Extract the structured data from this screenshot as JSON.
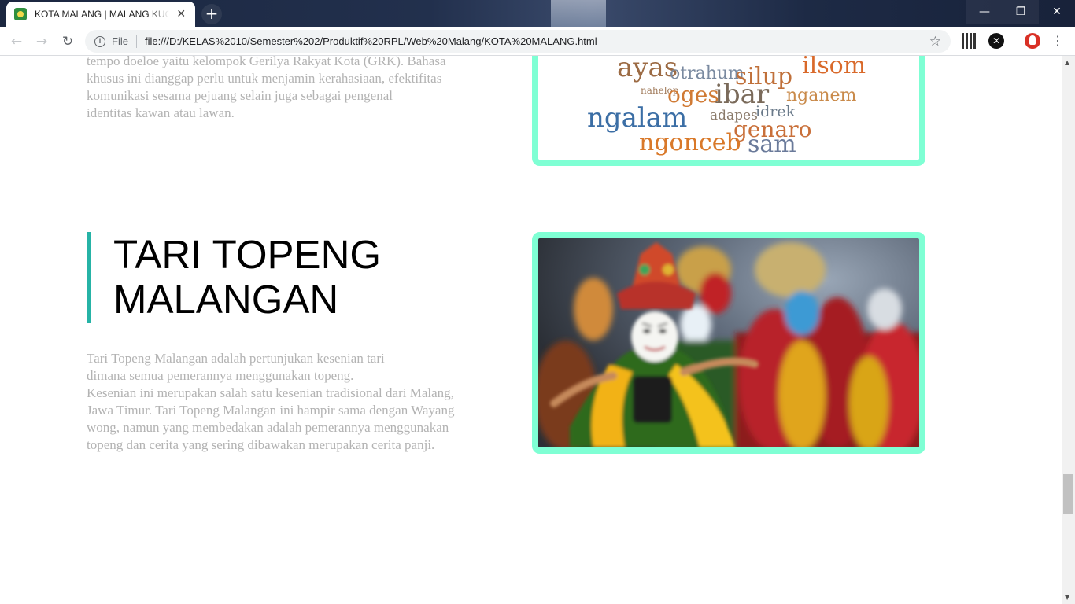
{
  "browser": {
    "tab_title": "KOTA MALANG | MALANG KUCECWARA",
    "tab_close": "✕",
    "new_tab": "+",
    "scheme_label": "File",
    "url": "file:///D:/KELAS%2010/Semester%202/Produktif%20RPL/Web%20Malang/KOTA%20MALANG.html",
    "window": {
      "minimize": "—",
      "maximize": "❐",
      "close": "✕"
    },
    "icons": {
      "back": "←",
      "forward": "→",
      "reload": "↻",
      "info": "i",
      "star": "☆",
      "menu": "⋮",
      "ext2": "✕"
    }
  },
  "previous_section": {
    "text_lines": [
      "tempo doeloe yaitu kelompok Gerilya Rakyat Kota (GRK). Bahasa",
      "khusus ini dianggap perlu untuk menjamin kerahasiaan, efektifitas",
      "komunikasi sesama pejuang selain juga sebagai pengenal",
      "identitas kawan atau lawan."
    ],
    "word_cloud": [
      {
        "word": "ayas",
        "color": "#9c6b44"
      },
      {
        "word": "otrahum",
        "color": "#7a8aa0"
      },
      {
        "word": "silup",
        "color": "#c0703a"
      },
      {
        "word": "ilsom",
        "color": "#d9692a"
      },
      {
        "word": "nahelop",
        "color": "#a07a5a"
      },
      {
        "word": "oges",
        "color": "#d07a34"
      },
      {
        "word": "ibar",
        "color": "#7a6a5a"
      },
      {
        "word": "nganem",
        "color": "#c98a4a"
      },
      {
        "word": "ngalam",
        "color": "#3b6ea5"
      },
      {
        "word": "adapes",
        "color": "#8a7a6a"
      },
      {
        "word": "idrek",
        "color": "#6a7a8a"
      },
      {
        "word": "genaro",
        "color": "#c9703a"
      },
      {
        "word": "ngonceb",
        "color": "#d9792a"
      },
      {
        "word": "sam",
        "color": "#6a7a9a"
      }
    ]
  },
  "tari_section": {
    "title_line1": "TARI TOPENG",
    "title_line2": "MALANGAN",
    "paragraph_lines": [
      "Tari Topeng Malangan adalah pertunjukan kesenian tari",
      "dimana semua pemerannya menggunakan topeng.",
      "Kesenian ini merupakan salah satu kesenian tradisional dari Malang,",
      "Jawa Timur. Tari Topeng Malangan ini hampir sama dengan Wayang",
      "wong, namun yang membedakan adalah pemerannya menggunakan",
      "topeng dan cerita yang sering dibawakan merupakan cerita panji."
    ]
  },
  "colors": {
    "frame_border": "#7fffd4",
    "title_bar_accent": "#26b3a6",
    "body_text": "#b3b3b3"
  }
}
